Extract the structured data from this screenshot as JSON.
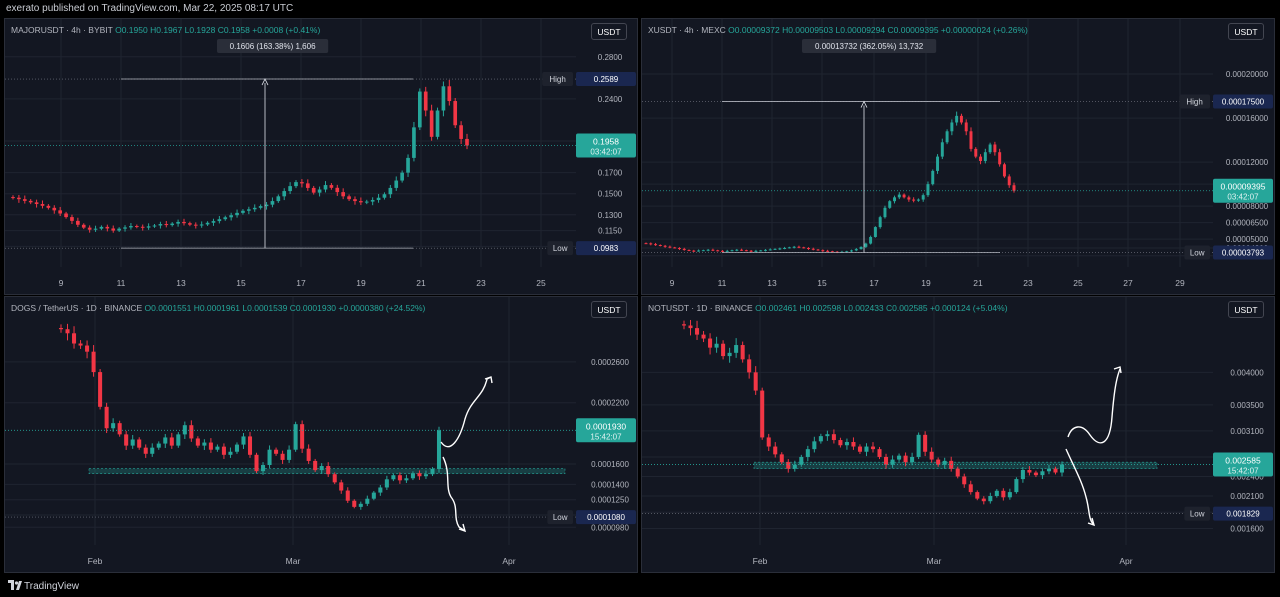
{
  "header": {
    "text": "exerato published on TradingView.com, Mar 22, 2025 08:17 UTC"
  },
  "footer": {
    "brand": "TradingView"
  },
  "colors": {
    "up": "#26a69a",
    "down": "#f23645",
    "bg": "#131722",
    "grid": "#1f2430",
    "axisText": "#b2b5be"
  },
  "chart_data": [
    {
      "type": "candlestick",
      "symbol_line": "MAJORUSDT · 4h · BYBIT",
      "ohlc": {
        "O": "O0.1950",
        "H": "H0.1967",
        "L": "L0.1928",
        "C": "C0.1958",
        "chg": "+0.0008 (+0.41%)"
      },
      "currency": "USDT",
      "y_ticks": [
        "0.2800",
        "0.2400",
        "0.2000",
        "0.1700",
        "0.1500",
        "0.1300",
        "0.1150",
        "0.1000"
      ],
      "x_ticks": [
        "9",
        "11",
        "13",
        "15",
        "17",
        "19",
        "21",
        "23",
        "25"
      ],
      "high_label": "High",
      "high_value": "0.2589",
      "low_label": "Low",
      "low_value": "0.0983",
      "last_price": "0.1958",
      "countdown": "03:42:07",
      "measure_text": "0.1606 (163.38%) 1,606",
      "ylim": [
        0.088,
        0.295
      ],
      "closes": [
        0.1462,
        0.1448,
        0.1432,
        0.1418,
        0.1402,
        0.1385,
        0.1366,
        0.1342,
        0.1312,
        0.1278,
        0.1242,
        0.1205,
        0.1178,
        0.1158,
        0.1168,
        0.1185,
        0.117,
        0.115,
        0.1168,
        0.118,
        0.1193,
        0.1186,
        0.1178,
        0.119,
        0.1198,
        0.1212,
        0.1202,
        0.1216,
        0.1232,
        0.122,
        0.1206,
        0.1198,
        0.1208,
        0.1224,
        0.124,
        0.1258,
        0.1276,
        0.1296,
        0.1318,
        0.1338,
        0.1352,
        0.1366,
        0.1382,
        0.1396,
        0.143,
        0.1475,
        0.1525,
        0.1572,
        0.161,
        0.1598,
        0.1555,
        0.151,
        0.154,
        0.1582,
        0.1556,
        0.1515,
        0.1475,
        0.1448,
        0.143,
        0.1418,
        0.1425,
        0.144,
        0.1462,
        0.1495,
        0.1555,
        0.1625,
        0.17,
        0.184,
        0.213,
        0.247,
        0.229,
        0.204,
        0.229,
        0.252,
        0.238,
        0.215,
        0.202,
        0.1958
      ]
    },
    {
      "type": "candlestick",
      "symbol_line": "XUSDT · 4h · MEXC",
      "ohlc": {
        "O": "O0.00009372",
        "H": "H0.00009503",
        "L": "L0.00009294",
        "C": "C0.00009395",
        "chg": "+0.00000024 (+0.26%)"
      },
      "currency": "USDT",
      "y_ticks": [
        "0.00020000",
        "0.00016000",
        "0.00012000",
        "0.00010000",
        "0.00008000",
        "0.00006500",
        "0.00005000",
        "0.00004200",
        "0.00003500"
      ],
      "x_ticks": [
        "9",
        "11",
        "13",
        "15",
        "17",
        "19",
        "21",
        "23",
        "25",
        "27",
        "29"
      ],
      "high_label": "High",
      "high_value": "0.00017500",
      "low_label": "Low",
      "low_value": "0.00003793",
      "last_price": "0.00009395",
      "countdown": "03:42:07",
      "measure_text": "0.00013732 (362.05%) 13,732",
      "ylim": [
        3.2e-05,
        0.00023
      ],
      "closes": [
        4.62e-05,
        4.55e-05,
        4.47e-05,
        4.4e-05,
        4.32e-05,
        4.25e-05,
        4.2e-05,
        4.12e-05,
        4.02e-05,
        3.96e-05,
        3.93e-05,
        3.97e-05,
        4e-05,
        4.04e-05,
        3.99e-05,
        3.94e-05,
        3.9e-05,
        3.94e-05,
        4e-05,
        4.04e-05,
        4e-05,
        3.95e-05,
        3.91e-05,
        3.94e-05,
        3.98e-05,
        4.03e-05,
        4.07e-05,
        4.12e-05,
        4.16e-05,
        4.2e-05,
        4.26e-05,
        4.31e-05,
        4.26e-05,
        4.2e-05,
        4.13e-05,
        4.06e-05,
        4e-05,
        3.94e-05,
        3.9e-05,
        3.86e-05,
        3.83e-05,
        3.85e-05,
        3.9e-05,
        3.98e-05,
        4.1e-05,
        4.3e-05,
        4.6e-05,
        5.2e-05,
        6.1e-05,
        7e-05,
        7.85e-05,
        8.45e-05,
        8.8e-05,
        9.05e-05,
        8.8e-05,
        8.6e-05,
        8.5e-05,
        8.6e-05,
        9e-05,
        0.0001,
        0.000112,
        0.000125,
        0.000138,
        0.000148,
        0.000156,
        0.000162,
        0.000156,
        0.000148,
        0.000132,
        0.000125,
        0.000121,
        0.000129,
        0.000136,
        0.000129,
        0.000118,
        0.000107,
        9.9e-05,
        9.4e-05
      ]
    },
    {
      "type": "candlestick",
      "symbol_line": "DOGS / TetherUS · 1D · BINANCE",
      "ohlc": {
        "O": "O0.0001551",
        "H": "H0.0001961",
        "L": "L0.0001539",
        "C": "C0.0001930",
        "chg": "+0.0000380 (+24.52%)"
      },
      "currency": "USDT",
      "y_ticks": [
        "0.0002600",
        "0.0002200",
        "0.0001600",
        "0.0001400",
        "0.0001250",
        "0.0001100",
        "0.0000980"
      ],
      "x_ticks": [
        "Feb",
        "Mar",
        "Apr"
      ],
      "high_label": "",
      "high_value": "",
      "low_label": "Low",
      "low_value": "0.0001080",
      "last_price": "0.0001930",
      "countdown": "15:42:07",
      "measure_text": "",
      "ylim": [
        8.85e-05,
        0.000302
      ],
      "closes": [
        0.000292,
        0.000288,
        0.000278,
        0.000276,
        0.00027,
        0.00025,
        0.000216,
        0.000195,
        0.0002,
        0.000189,
        0.000178,
        0.000184,
        0.000176,
        0.00017,
        0.000176,
        0.00018,
        0.000186,
        0.000178,
        0.000189,
        0.000198,
        0.000185,
        0.000178,
        0.000181,
        0.000174,
        0.000177,
        0.000169,
        0.000172,
        0.000179,
        0.000187,
        0.000169,
        0.000153,
        0.000159,
        0.000174,
        0.00017,
        0.000164,
        0.000174,
        0.000199,
        0.000175,
        0.000163,
        0.000154,
        0.000158,
        0.00015,
        0.000142,
        0.000134,
        0.000124,
        0.000118,
        0.000121,
        0.000126,
        0.000132,
        0.000137,
        0.000145,
        0.000149,
        0.000144,
        0.000146,
        0.000151,
        0.000148,
        0.00015,
        0.0001551,
        0.000193
      ]
    },
    {
      "type": "candlestick",
      "symbol_line": "NOTUSDT · 1D · BINANCE",
      "ohlc": {
        "O": "O0.002461",
        "H": "H0.002598",
        "L": "L0.002433",
        "C": "C0.002585",
        "chg": "+0.000124 (+5.04%)"
      },
      "currency": "USDT",
      "y_ticks": [
        "0.004000",
        "0.003500",
        "0.003100",
        "0.002700",
        "0.002400",
        "0.002100",
        "0.001850",
        "0.001600"
      ],
      "x_ticks": [
        "Feb",
        "Mar",
        "Apr"
      ],
      "high_label": "",
      "high_value": "",
      "low_label": "Low",
      "low_value": "0.001829",
      "last_price": "0.002585",
      "countdown": "15:42:07",
      "measure_text": "",
      "ylim": [
        0.00147,
        0.00482
      ],
      "closes": [
        0.00472,
        0.00468,
        0.00458,
        0.00452,
        0.00438,
        0.00444,
        0.00425,
        0.0043,
        0.00442,
        0.0042,
        0.004,
        0.00372,
        0.003,
        0.00286,
        0.00274,
        0.00262,
        0.00252,
        0.00258,
        0.0027,
        0.00282,
        0.00294,
        0.00302,
        0.00305,
        0.00296,
        0.00288,
        0.00293,
        0.00286,
        0.00278,
        0.00286,
        0.00282,
        0.0027,
        0.00258,
        0.00266,
        0.00272,
        0.00262,
        0.0027,
        0.00304,
        0.00278,
        0.00266,
        0.00258,
        0.00264,
        0.00252,
        0.0024,
        0.00228,
        0.00216,
        0.00206,
        0.00202,
        0.0021,
        0.00218,
        0.00208,
        0.00216,
        0.00236,
        0.0025,
        0.00246,
        0.00242,
        0.00248,
        0.00252,
        0.002461,
        0.002585
      ]
    }
  ]
}
